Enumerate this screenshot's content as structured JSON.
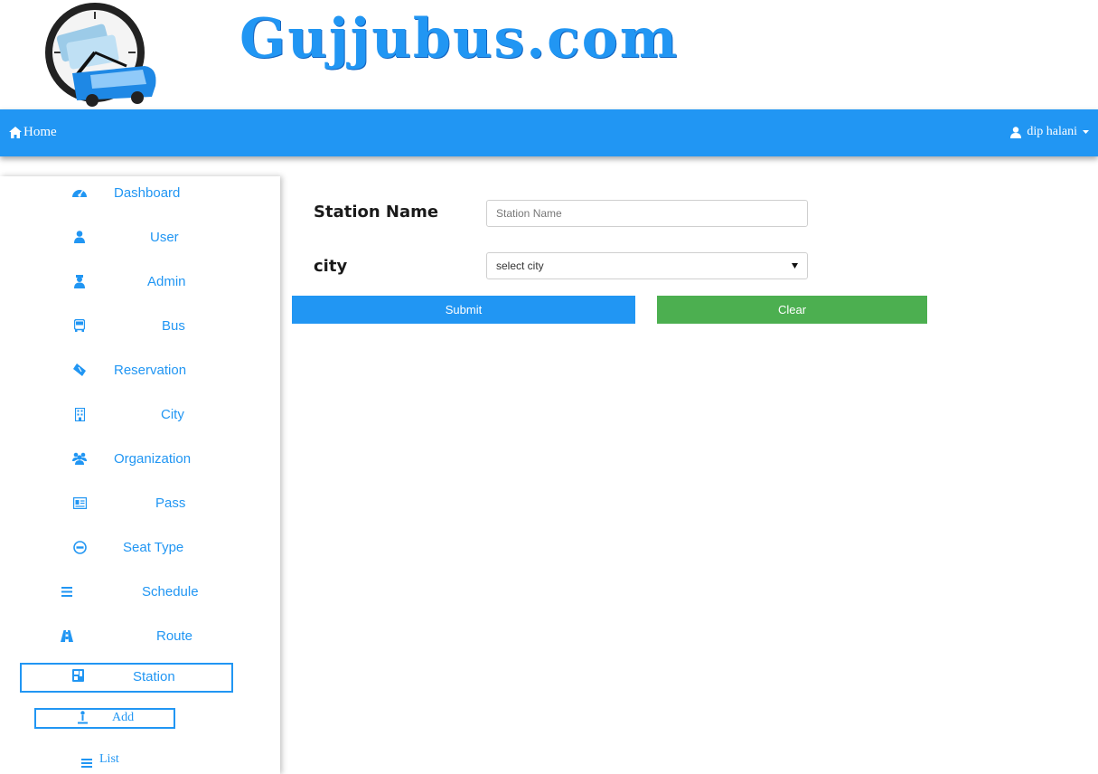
{
  "site": {
    "title": "Gujjubus.com"
  },
  "navbar": {
    "home_label": "Home",
    "user_label": "dip halani"
  },
  "sidebar": {
    "items": [
      {
        "label": "Dashboard",
        "icon": "dashboard-icon"
      },
      {
        "label": "User",
        "icon": "user-icon"
      },
      {
        "label": "Admin",
        "icon": "admin-icon"
      },
      {
        "label": "Bus",
        "icon": "bus-icon"
      },
      {
        "label": "Reservation",
        "icon": "ticket-icon"
      },
      {
        "label": "City",
        "icon": "building-icon"
      },
      {
        "label": "Organization",
        "icon": "group-icon"
      },
      {
        "label": "Pass",
        "icon": "id-card-icon"
      },
      {
        "label": "Seat Type",
        "icon": "minus-circle-icon"
      },
      {
        "label": "Schedule",
        "icon": "bars-icon"
      },
      {
        "label": "Route",
        "icon": "road-icon"
      },
      {
        "label": "Station",
        "icon": "station-icon"
      }
    ],
    "sub_items": [
      {
        "label": "Add",
        "icon": "person-add-icon"
      },
      {
        "label": "List",
        "icon": "list-icon"
      }
    ]
  },
  "form": {
    "station_name_label": "Station Name",
    "station_name_placeholder": "Station Name",
    "city_label": "city",
    "city_selected": "select city",
    "submit_label": "Submit",
    "clear_label": "Clear"
  },
  "colors": {
    "primary": "#2196f3",
    "success": "#4caf50"
  }
}
